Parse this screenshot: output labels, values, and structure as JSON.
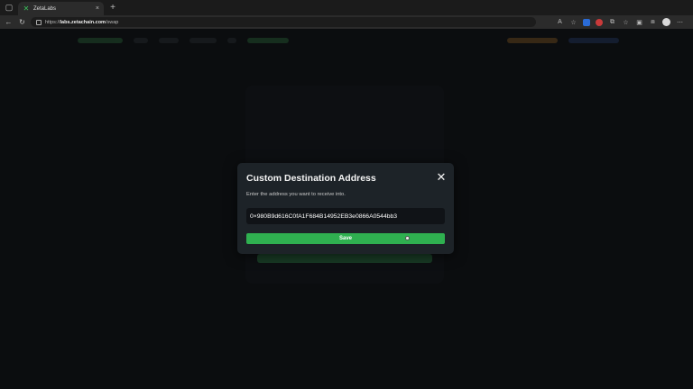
{
  "browser": {
    "tab_title": "ZetaLabs",
    "tab_close": "×",
    "new_tab": "+",
    "url_host": "labs.zetachain.com",
    "url_scheme": "https://",
    "url_path": "/swap"
  },
  "modal": {
    "title": "Custom Destination Address",
    "close_glyph": "✕",
    "description": "Enter the address you want to receive into.",
    "address_value": "0×980B9d616C0fA1F684B14952EB3e0866A0544bb3",
    "save_label": "Save"
  },
  "colors": {
    "accent_green": "#2fb050",
    "modal_bg": "#1d2328"
  }
}
